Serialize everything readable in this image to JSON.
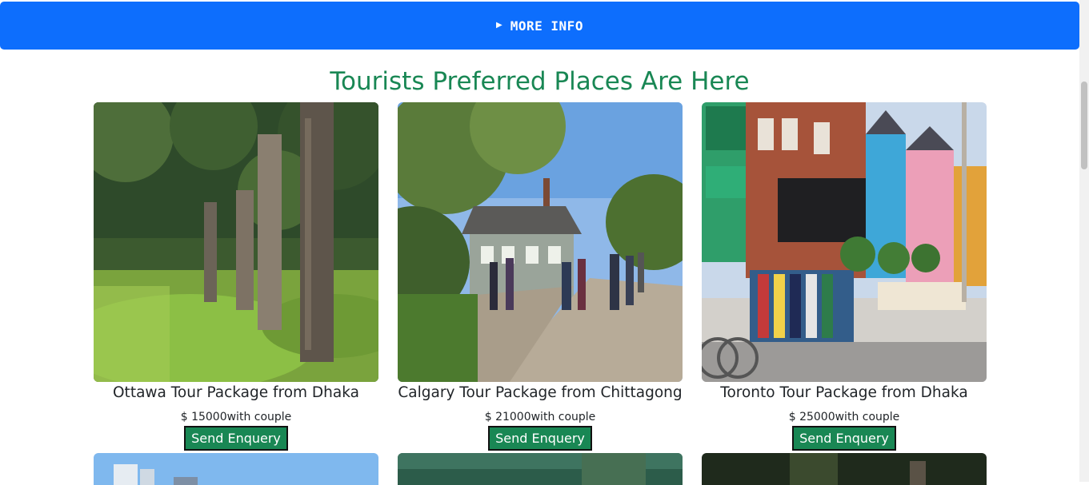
{
  "header_bar": {
    "label": "MORE INFO",
    "caret_icon": "caret-right-icon",
    "color": "#0d6efd"
  },
  "section": {
    "title": "Tourists Preferred Places Are Here",
    "title_color": "#198754"
  },
  "accent": {
    "button_bg": "#198754"
  },
  "cards": [
    {
      "title": "Ottawa Tour Package from Dhaka",
      "currency": "$",
      "price": "15000",
      "note": "with couple",
      "button": "Send Enquery",
      "image": "totem-poles-forest-photo"
    },
    {
      "title": "Calgary Tour Package from Chittagong",
      "currency": "$",
      "price": "21000",
      "note": "with couple",
      "button": "Send Enquery",
      "image": "heritage-village-path-photo"
    },
    {
      "title": "Toronto Tour Package from Dhaka",
      "currency": "$",
      "price": "25000",
      "note": "with couple",
      "button": "Send Enquery",
      "image": "kensington-market-street-photo"
    }
  ],
  "next_row_images": [
    "city-skyline-photo",
    "lake-forest-photo",
    "dark-forest-photo"
  ]
}
